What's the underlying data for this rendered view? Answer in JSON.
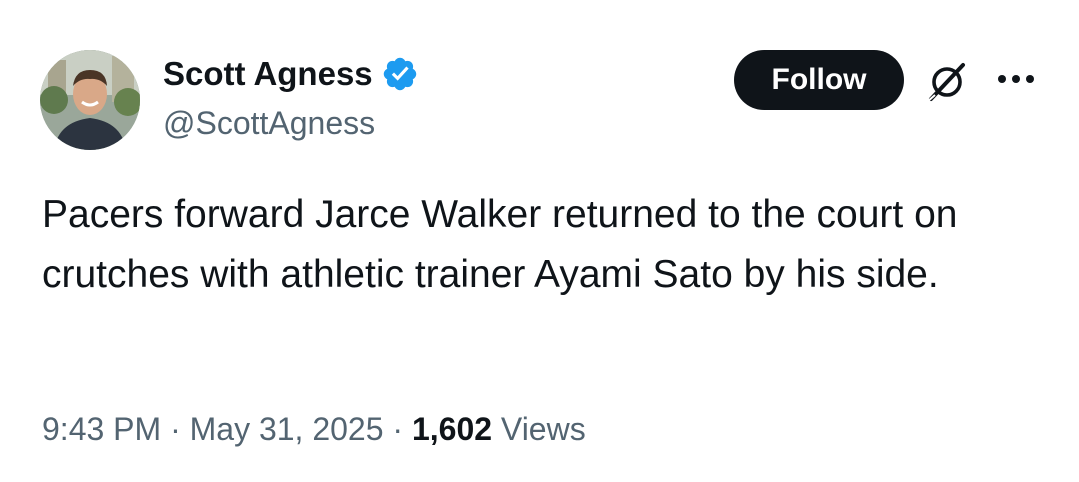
{
  "author": {
    "display_name": "Scott Agness",
    "handle": "@ScottAgness",
    "verified": true,
    "verified_color": "#1d9bf0"
  },
  "actions": {
    "follow_label": "Follow",
    "grok_icon": "grok-icon",
    "more_icon": "more-horizontal-icon"
  },
  "tweet": {
    "text": "Pacers forward Jarce Walker returned to the court on crutches with athletic trainer Ayami Sato by his side."
  },
  "meta": {
    "time": "9:43 PM",
    "separator": "·",
    "date": "May 31, 2025",
    "views_count": "1,602",
    "views_label": "Views"
  },
  "colors": {
    "text_primary": "#0f1419",
    "text_secondary": "#536471",
    "button_bg": "#0f1419",
    "button_text": "#ffffff"
  }
}
